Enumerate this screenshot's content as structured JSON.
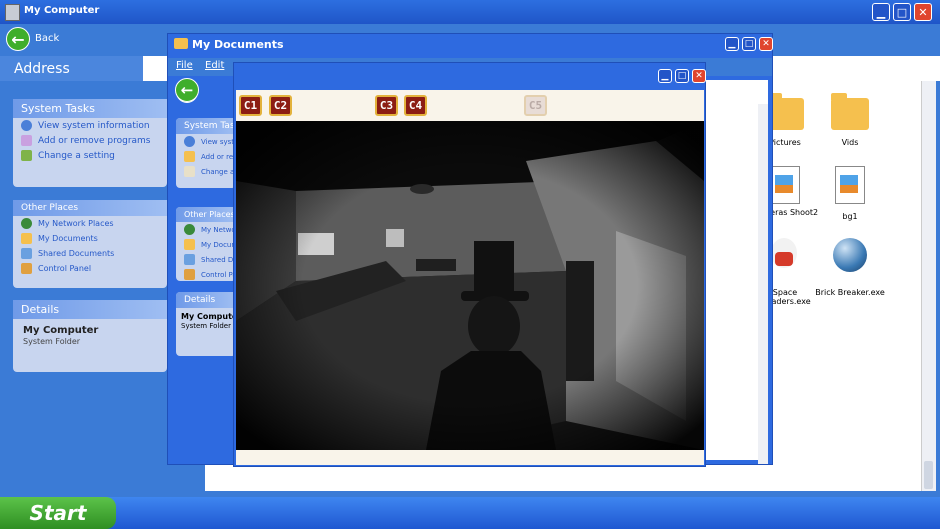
{
  "main_window": {
    "title": "My Computer"
  },
  "nav": {
    "back_label": "Back",
    "address_label": "Address"
  },
  "system_tasks": {
    "heading": "System Tasks",
    "items": [
      "View system information",
      "Add or remove programs",
      "Change a setting"
    ]
  },
  "other_places": {
    "heading": "Other Places",
    "items": [
      "My Network Places",
      "My Documents",
      "Shared Documents",
      "Control Panel"
    ]
  },
  "details": {
    "heading": "Details",
    "name": "My Computer",
    "type": "System Folder"
  },
  "files": [
    {
      "label": "Pictures",
      "icon": "folder-icon"
    },
    {
      "label": "Vids",
      "icon": "folder-icon"
    },
    {
      "label": "Cameras Shoot2",
      "icon": "image-file-icon"
    },
    {
      "label": "bg1",
      "icon": "image-file-icon"
    },
    {
      "label": "Space Invaders.exe",
      "icon": "chicken-icon"
    },
    {
      "label": "Brick Breaker.exe",
      "icon": "ball-icon"
    }
  ],
  "docs_window": {
    "title": "My Documents",
    "menu": [
      "File",
      "Edit"
    ],
    "system_tasks": {
      "heading": "System Tasks",
      "items": [
        "View system information",
        "Add or remove programs",
        "Change a setting"
      ]
    },
    "other_places": {
      "heading": "Other Places",
      "items": [
        "My Network Places",
        "My Documents",
        "Shared Documents",
        "Control Panel"
      ]
    },
    "details": {
      "heading": "Details",
      "name": "My Computer",
      "type": "System Folder"
    }
  },
  "camera_window": {
    "buttons": [
      {
        "label": "C1",
        "state": "active"
      },
      {
        "label": "C2",
        "state": "active"
      },
      {
        "label": "C3",
        "state": "active"
      },
      {
        "label": "C4",
        "state": "active"
      },
      {
        "label": "C5",
        "state": "disabled"
      }
    ]
  },
  "taskbar": {
    "start_label": "Start"
  },
  "colors": {
    "title_blue": "#2d6fe0",
    "start_green": "#3fae2c",
    "close_red": "#e0452e",
    "cam_button": "#8c1d13"
  }
}
